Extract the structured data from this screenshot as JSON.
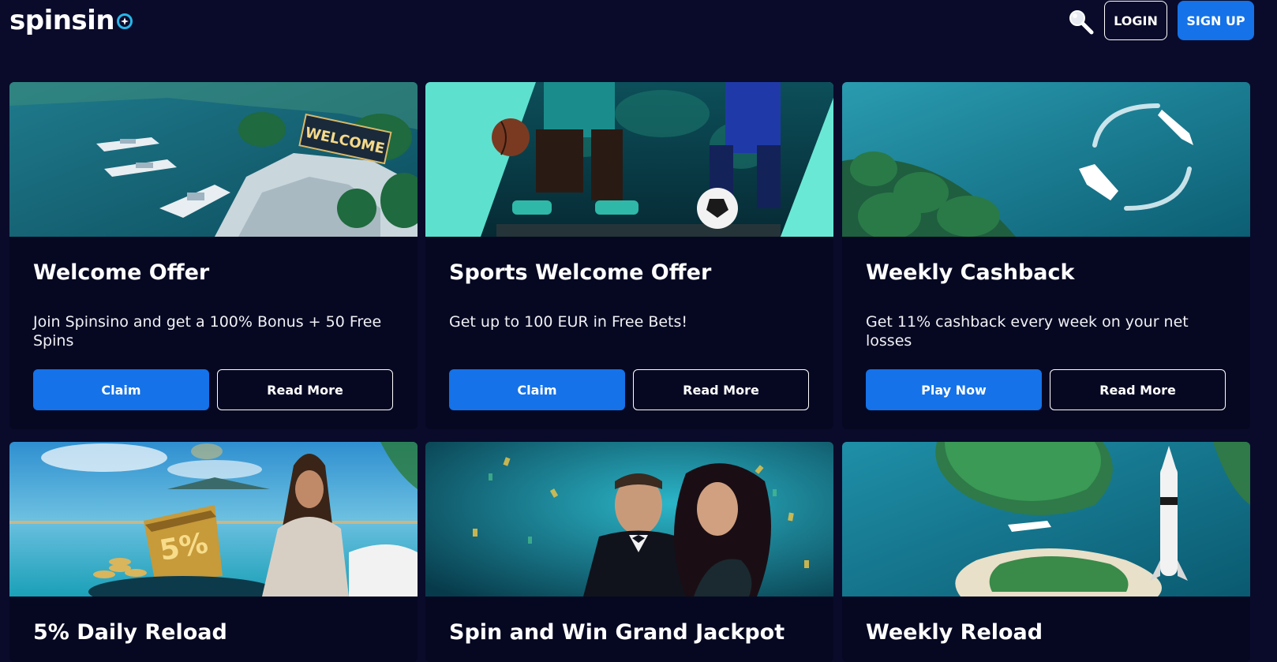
{
  "header": {
    "logo_text": "spinsin",
    "search_icon": "search-icon",
    "login_label": "LOGIN",
    "signup_label": "SIGN UP"
  },
  "colors": {
    "background": "#0a0b2a",
    "card": "#060822",
    "accent": "#1572e8"
  },
  "promotions": [
    {
      "title": "Welcome Offer",
      "description": "Join Spinsino and get a 100% Bonus + 50 Free Spins",
      "primary_label": "Claim",
      "secondary_label": "Read More",
      "banner_text": "WELCOME"
    },
    {
      "title": "Sports Welcome Offer",
      "description": "Get up to 100 EUR in Free Bets!",
      "primary_label": "Claim",
      "secondary_label": "Read More"
    },
    {
      "title": "Weekly Cashback",
      "description": "Get 11% cashback every week on your net losses",
      "primary_label": "Play Now",
      "secondary_label": "Read More"
    },
    {
      "title": "5% Daily Reload",
      "calendar_text": "5%"
    },
    {
      "title": "Spin and Win Grand Jackpot"
    },
    {
      "title": "Weekly Reload"
    }
  ]
}
